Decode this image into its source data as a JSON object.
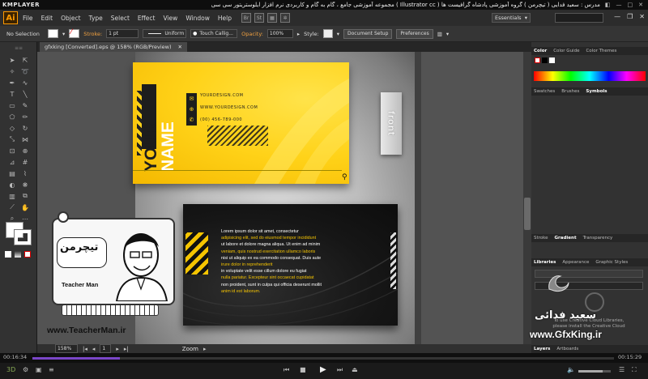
{
  "kmp": {
    "logo": "KMPLAYER",
    "title": "مجموعه آموزشی جامع ، گام به گام و کاربردی نرم افزار ایلوستریتور سی سی ( Illustrator cc )   مدرس : سعید فدایی ( تیچرمن ) گروه آموزشی پادشاه گرافیست ها",
    "time_elapsed": "00:16:34",
    "time_total": "00:15:29",
    "progress": 0.15
  },
  "menu": {
    "items": [
      "File",
      "Edit",
      "Object",
      "Type",
      "Select",
      "Effect",
      "View",
      "Window",
      "Help"
    ],
    "workspace": "Essentials"
  },
  "control": {
    "selection": "No Selection",
    "stroke_label": "Stroke:",
    "stroke_weight": "1 pt",
    "stroke_profile": "Uniform",
    "brush": "Touch Callig...",
    "opacity_label": "Opacity:",
    "opacity": "100%",
    "style_label": "Style:",
    "doc_setup": "Document Setup",
    "preferences": "Preferences"
  },
  "document": {
    "tab": "gfxking [Converted].eps @ 158% (RGB/Preview)",
    "zoom": "158%",
    "page": "1",
    "status": "Zoom"
  },
  "card_front": {
    "name_line1": "YOUR",
    "name_line2": "NAME",
    "email": "YOURDESIGN.COM",
    "web": "WWW.YOURDESIGN.COM",
    "phone": "(00) 456-789-000",
    "label": "front"
  },
  "card_back": {
    "lines": [
      "Lorem ipsum dolor sit amet, consectetur",
      "adipisicing elit, sed do eiusmod tempor incididunt",
      "ut labore et dolore magna aliqua. Ut enim ad minim",
      "veniam, quis nostrud exercitation ullamco laboris",
      "nisi ut aliquip ex ea commodo consequat. Duis aute",
      "irure dolor in reprehenderit",
      "in voluptate velit esse cillum dolore eu fugiat",
      "nulla pariatur. Excepteur sint occaecat cupidatat",
      "non proident, sunt in culpa qui officia deserunt mollit",
      "anim id est laborum."
    ],
    "line_colors": [
      "#ffffff",
      "#f5c400",
      "#ffffff",
      "#f5c400",
      "#ffffff",
      "#f5c400",
      "#ffffff",
      "#f5c400",
      "#ffffff",
      "#f5c400"
    ]
  },
  "panels": {
    "color_tabs": [
      "Color",
      "Color Guide",
      "Color Themes"
    ],
    "swatch_tabs": [
      "Swatches",
      "Brushes",
      "Symbols"
    ],
    "stroke_tabs": [
      "Stroke",
      "Gradient",
      "Transparency"
    ],
    "lib_tabs": [
      "Libraries",
      "Appearance",
      "Graphic Styles"
    ],
    "lib_msg1": "To use Creative Cloud Libraries,",
    "lib_msg2": "please install the Creative Cloud",
    "layer_tabs": [
      "Layers",
      "Artboards"
    ]
  },
  "watermarks": {
    "teacher_brand": "تیچرمن",
    "teacher_name": "Teacher Man",
    "teacher_url": "www.TeacherMan.ir",
    "saeed": "سعید فدائی",
    "gfxking": "www.GfxKing.ir"
  }
}
